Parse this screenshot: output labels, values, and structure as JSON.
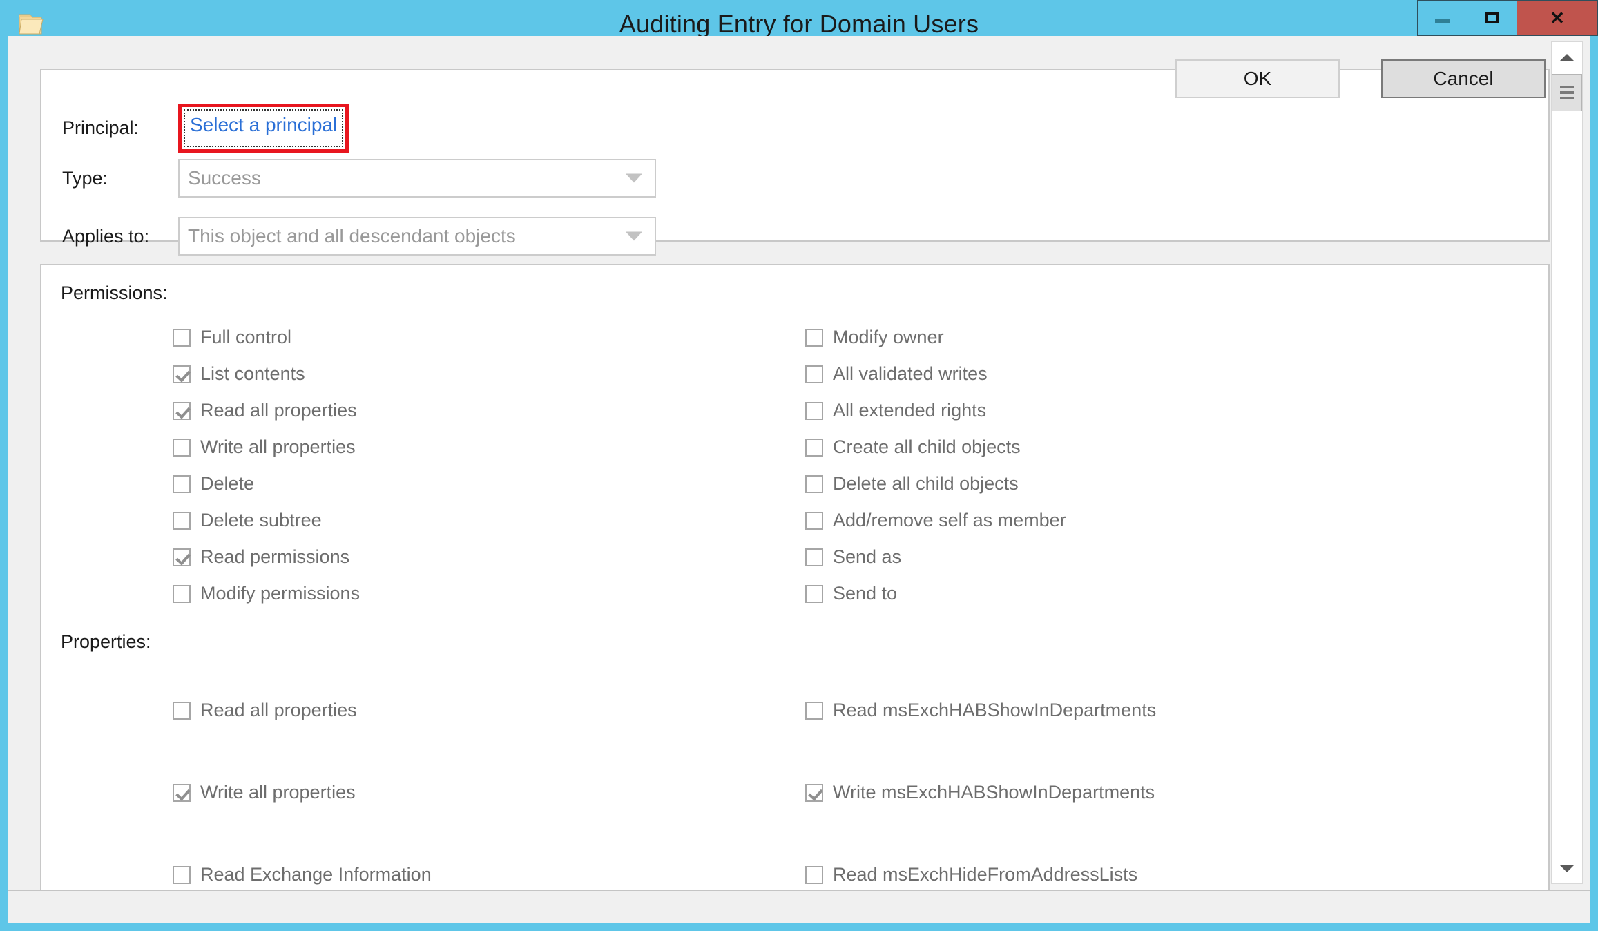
{
  "window": {
    "title": "Auditing Entry for Domain Users",
    "icon": "folder-icon",
    "accent_color": "#5ec6e8",
    "close_color": "#c0544d",
    "controls": {
      "minimize": "minimize-icon",
      "maximize": "maximize-icon",
      "close": "close-icon"
    }
  },
  "fields": {
    "principal": {
      "label": "Principal:",
      "link": "Select a principal",
      "link_color": "#2a6fd6",
      "highlight_color": "#e8161f"
    },
    "type": {
      "label": "Type:",
      "value": "Success"
    },
    "applies_to": {
      "label": "Applies to:",
      "value": "This object and all descendant objects"
    }
  },
  "permissions": {
    "label": "Permissions:",
    "left": [
      {
        "label": "Full control",
        "checked": false
      },
      {
        "label": "List contents",
        "checked": true
      },
      {
        "label": "Read all properties",
        "checked": true
      },
      {
        "label": "Write all properties",
        "checked": false
      },
      {
        "label": "Delete",
        "checked": false
      },
      {
        "label": "Delete subtree",
        "checked": false
      },
      {
        "label": "Read permissions",
        "checked": true
      },
      {
        "label": "Modify permissions",
        "checked": false
      }
    ],
    "right": [
      {
        "label": "Modify owner",
        "checked": false
      },
      {
        "label": "All validated writes",
        "checked": false
      },
      {
        "label": "All extended rights",
        "checked": false
      },
      {
        "label": "Create all child objects",
        "checked": false
      },
      {
        "label": "Delete all child objects",
        "checked": false
      },
      {
        "label": "Add/remove self as member",
        "checked": false
      },
      {
        "label": "Send as",
        "checked": false
      },
      {
        "label": "Send to",
        "checked": false
      }
    ]
  },
  "properties": {
    "label": "Properties:",
    "left": [
      {
        "label": "Read all properties",
        "checked": false
      },
      {
        "label": "Write all properties",
        "checked": true
      },
      {
        "label": "Read Exchange Information",
        "checked": false
      }
    ],
    "right": [
      {
        "label": "Read msExchHABShowInDepartments",
        "checked": false
      },
      {
        "label": "Write msExchHABShowInDepartments",
        "checked": true
      },
      {
        "label": "Read msExchHideFromAddressLists",
        "checked": false
      }
    ]
  },
  "scrollbar": {
    "up_arrow": "chevron-up-icon",
    "down_arrow": "chevron-down-icon",
    "thumb": "scrollbar-thumb"
  },
  "footer": {
    "ok_label": "OK",
    "cancel_label": "Cancel"
  }
}
